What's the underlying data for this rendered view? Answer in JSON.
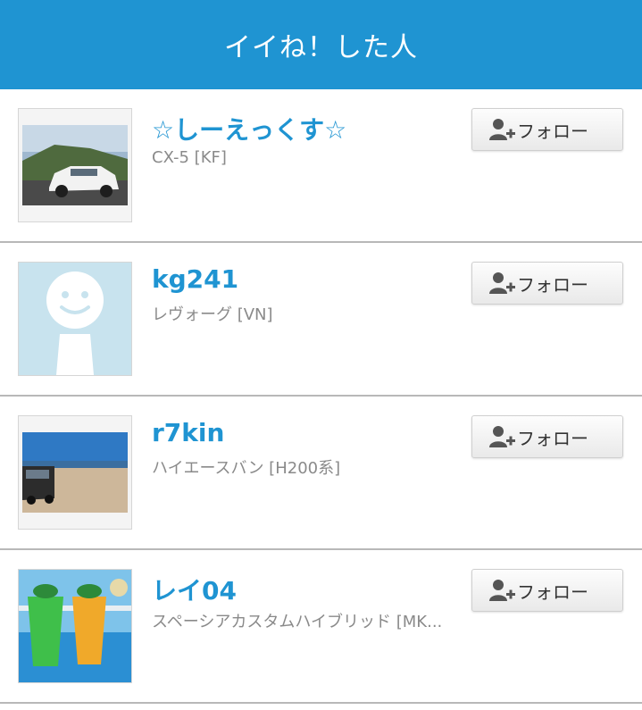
{
  "header": {
    "title": "イイね！した人"
  },
  "users": [
    {
      "name": "☆しーえっくす☆",
      "car": "CX-5 [KF]",
      "follow_label": "フォロー",
      "avatar": "car-photo"
    },
    {
      "name": "kg241",
      "car": "レヴォーグ [VN]",
      "follow_label": "フォロー",
      "avatar": "default-smiley"
    },
    {
      "name": "r7kin",
      "car": "ハイエースバン [H200系]",
      "follow_label": "フォロー",
      "avatar": "van-beach-photo"
    },
    {
      "name": "レイ04",
      "car": "スペーシアカスタムハイブリッド [MK...",
      "follow_label": "フォロー",
      "avatar": "drinks-photo"
    }
  ],
  "icons": {
    "follow": "add-user-icon"
  },
  "colors": {
    "header_bg": "#1f94d2",
    "name_text": "#1f94d2",
    "subtext": "#8a8a8a"
  }
}
